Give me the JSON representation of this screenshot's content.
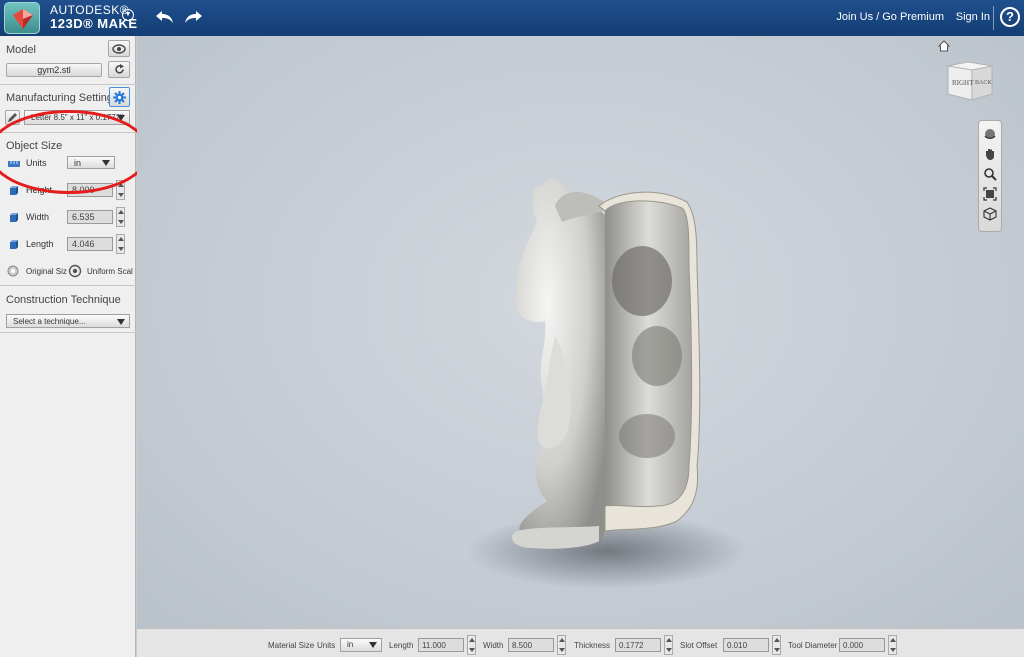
{
  "app": {
    "brand_line1": "AUTODESK®",
    "brand_line2": "123D® MAKE"
  },
  "header": {
    "join_link": "Join Us / Go Premium",
    "signin_link": "Sign In",
    "help_label": "?"
  },
  "panel": {
    "model": {
      "title": "Model",
      "file_name": "gym2.stl"
    },
    "manufacturing": {
      "title": "Manufacturing Settings",
      "preset": "Letter 8.5\" x 11\" x 0.1772\""
    },
    "object_size": {
      "title": "Object Size",
      "units_label": "Units",
      "units_value": "in",
      "height_label": "Height",
      "height_value": "8.000",
      "width_label": "Width",
      "width_value": "6.535",
      "length_label": "Length",
      "length_value": "4.046",
      "original_size_label": "Original Siz",
      "uniform_scale_label": "Uniform Scal"
    },
    "construction": {
      "title": "Construction Technique",
      "placeholder": "Select a technique..."
    }
  },
  "viewcube": {
    "face_right": "RIGHT",
    "face_back": "BACK"
  },
  "bottom": {
    "material_size_label": "Material Size",
    "units_label": "Units",
    "units_value": "in",
    "length_label": "Length",
    "length_value": "11.000",
    "width_label": "Width",
    "width_value": "8.500",
    "thickness_label": "Thickness",
    "thickness_value": "0.1772",
    "slot_offset_label": "Slot Offset",
    "slot_offset_value": "0.010",
    "tool_diameter_label": "Tool Diameter",
    "tool_diameter_value": "0.000"
  },
  "colors": {
    "topbar": "#1a4780",
    "annotation": "#e41c1c",
    "viewport": "#c5cbd3"
  }
}
